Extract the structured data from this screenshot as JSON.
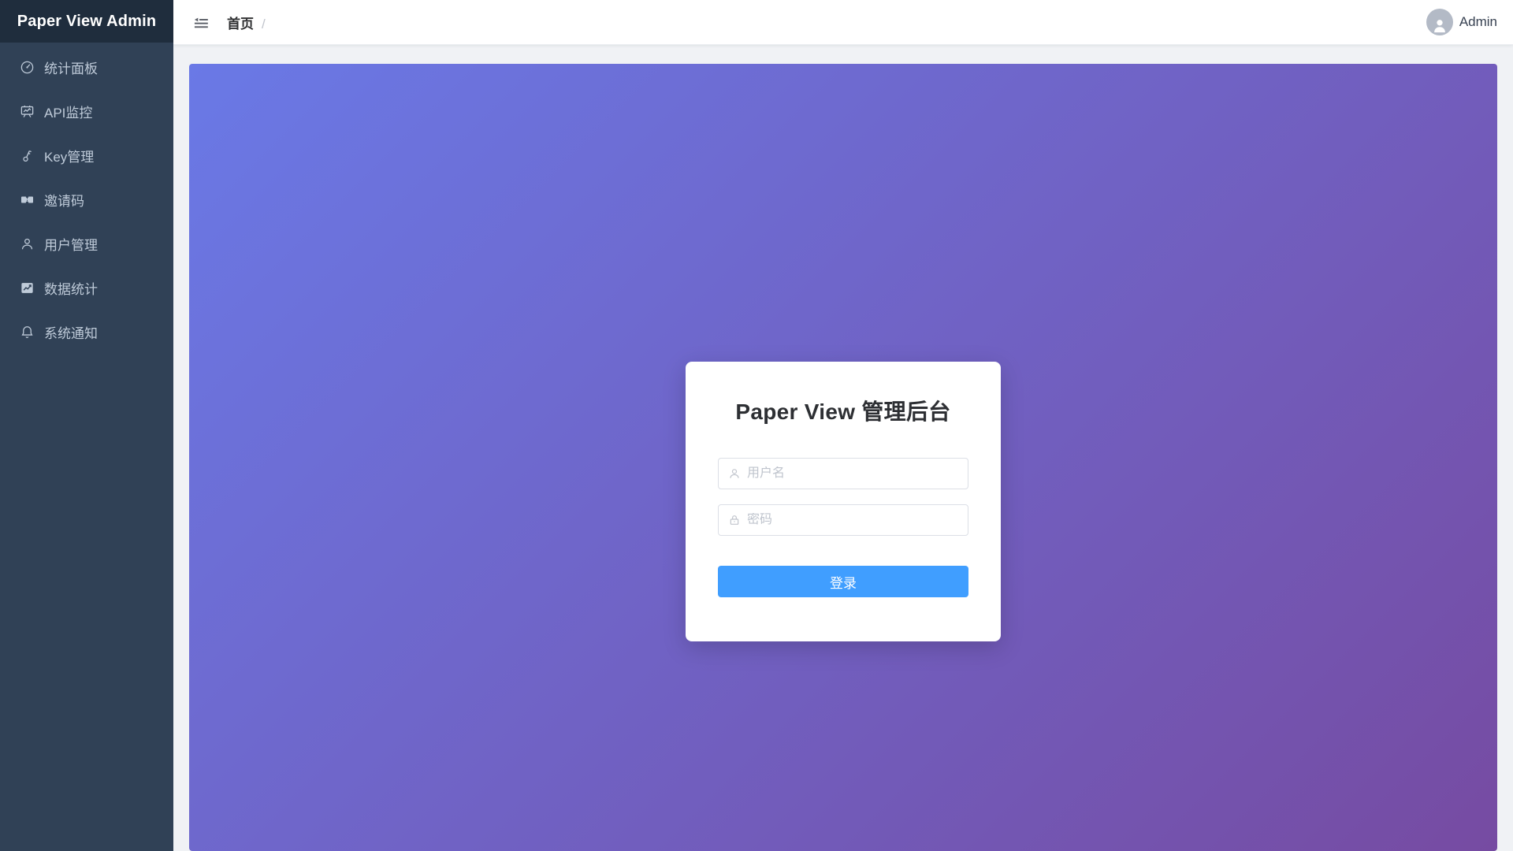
{
  "app": {
    "title": "Paper View Admin"
  },
  "sidebar": {
    "items": [
      {
        "label": "统计面板",
        "icon": "dashboard-icon"
      },
      {
        "label": "API监控",
        "icon": "monitor-icon"
      },
      {
        "label": "Key管理",
        "icon": "key-icon"
      },
      {
        "label": "邀请码",
        "icon": "ticket-icon"
      },
      {
        "label": "用户管理",
        "icon": "user-icon"
      },
      {
        "label": "数据统计",
        "icon": "chart-icon"
      },
      {
        "label": "系统通知",
        "icon": "bell-icon"
      }
    ]
  },
  "topbar": {
    "breadcrumb": "首页",
    "breadcrumb_separator": "/",
    "user": "Admin"
  },
  "login": {
    "title": "Paper View 管理后台",
    "username_placeholder": "用户名",
    "password_placeholder": "密码",
    "submit_label": "登录"
  },
  "colors": {
    "gradient_start": "#6a79e6",
    "gradient_end": "#764ba2",
    "accent": "#409eff",
    "sidebar_bg": "#304156",
    "sidebar_logo_bg": "#1f2d3d",
    "sidebar_text": "#bfcbd9",
    "page_bg": "#f0f2f5"
  }
}
